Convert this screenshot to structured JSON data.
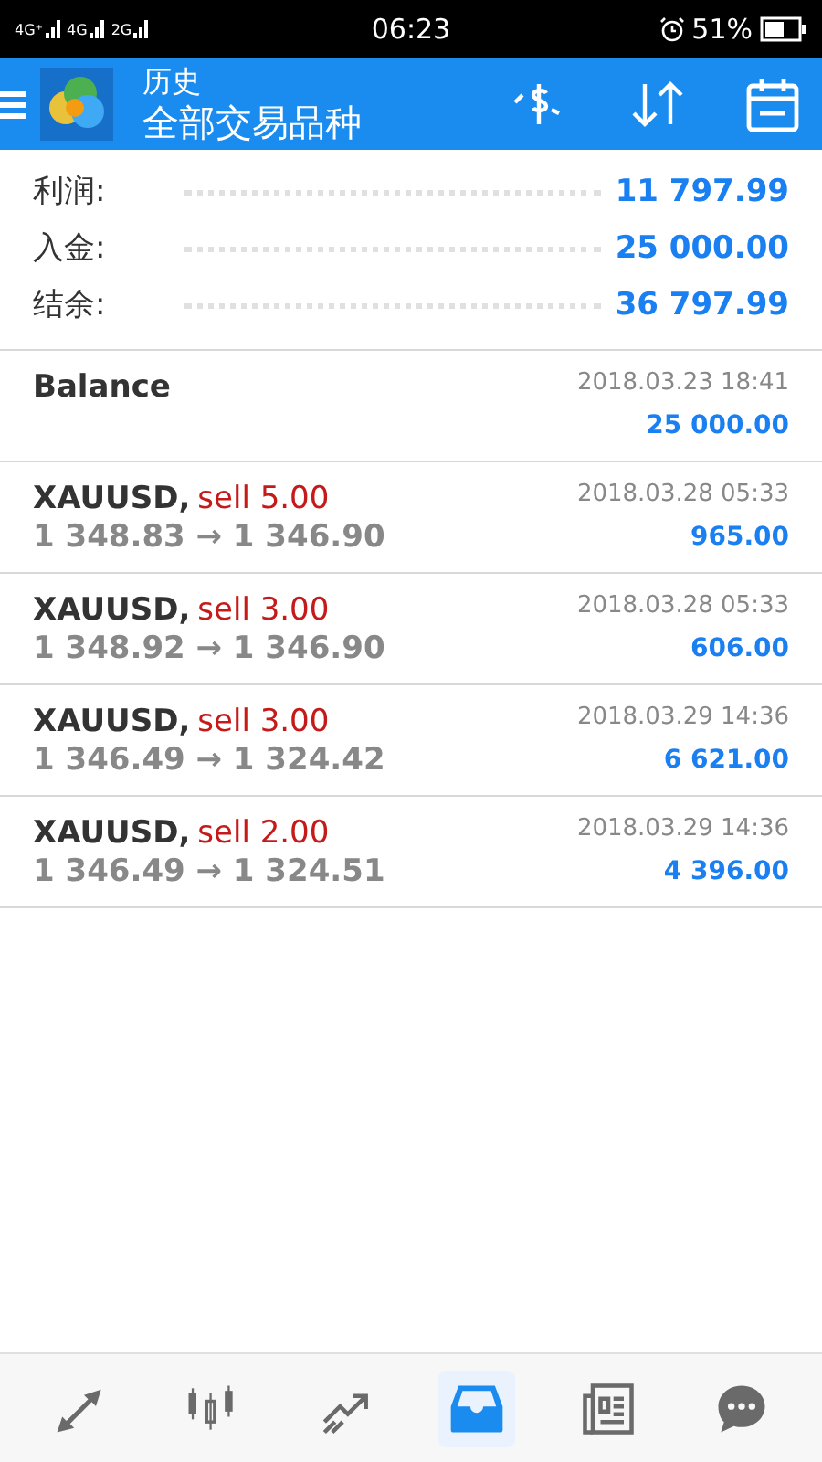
{
  "status_bar": {
    "networks": [
      "4G⁺",
      "4G",
      "2G"
    ],
    "time": "06:23",
    "battery": "51%"
  },
  "toolbar": {
    "title": "历史",
    "subtitle": "全部交易品种"
  },
  "summary": [
    {
      "label": "利润:",
      "value": "11 797.99"
    },
    {
      "label": "入金:",
      "value": "25 000.00"
    },
    {
      "label": "结余:",
      "value": "36 797.99"
    }
  ],
  "deals": [
    {
      "kind": "balance",
      "symbol": "Balance",
      "time": "2018.03.23 18:41",
      "amount": "25 000.00"
    },
    {
      "kind": "trade",
      "symbol": "XAUUSD,",
      "side": "sell 5.00",
      "prices": "1 348.83 → 1 346.90",
      "time": "2018.03.28 05:33",
      "amount": "965.00"
    },
    {
      "kind": "trade",
      "symbol": "XAUUSD,",
      "side": "sell 3.00",
      "prices": "1 348.92 → 1 346.90",
      "time": "2018.03.28 05:33",
      "amount": "606.00"
    },
    {
      "kind": "trade",
      "symbol": "XAUUSD,",
      "side": "sell 3.00",
      "prices": "1 346.49 → 1 324.42",
      "time": "2018.03.29 14:36",
      "amount": "6 621.00"
    },
    {
      "kind": "trade",
      "symbol": "XAUUSD,",
      "side": "sell 2.00",
      "prices": "1 346.49 → 1 324.51",
      "time": "2018.03.29 14:36",
      "amount": "4 396.00"
    }
  ],
  "bottom_nav": [
    {
      "kind": "quotes",
      "selected": false
    },
    {
      "kind": "chart",
      "selected": false
    },
    {
      "kind": "trade",
      "selected": false
    },
    {
      "kind": "history",
      "selected": true
    },
    {
      "kind": "news",
      "selected": false
    },
    {
      "kind": "chat",
      "selected": false
    }
  ]
}
